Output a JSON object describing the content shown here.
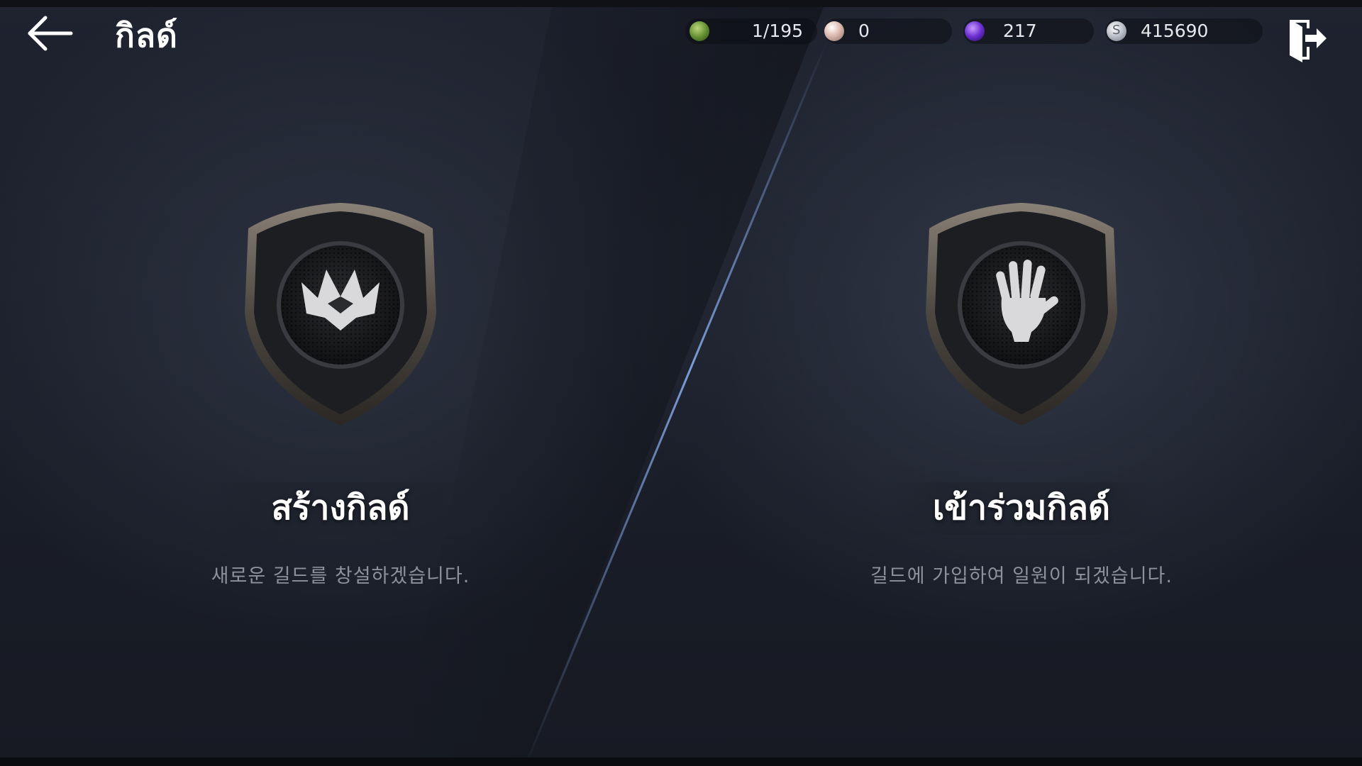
{
  "header": {
    "title": "กิลด์",
    "back_icon": "arrow-left-icon",
    "exit_icon": "exit-door-icon"
  },
  "currencies": [
    {
      "id": "guild-points",
      "icon": "green-shield-icon",
      "value": "1/195"
    },
    {
      "id": "pearl",
      "icon": "pearl-icon",
      "value": "0"
    },
    {
      "id": "purple-gem",
      "icon": "purple-gem-icon",
      "value": "217"
    },
    {
      "id": "silver",
      "icon": "silver-coin-icon",
      "value": "415690"
    }
  ],
  "options": {
    "create": {
      "title": "สร้างกิลด์",
      "description": "새로운 길드를 창설하겠습니다.",
      "icon": "crown-shield-icon"
    },
    "join": {
      "title": "เข้าร่วมกิลด์",
      "description": "길드에 가입하여 일원이 되겠습니다.",
      "icon": "hand-shield-icon"
    }
  },
  "colors": {
    "accent_divider": "#6f8fc9",
    "text_primary": "#ffffff",
    "text_secondary": "#8d919b"
  }
}
